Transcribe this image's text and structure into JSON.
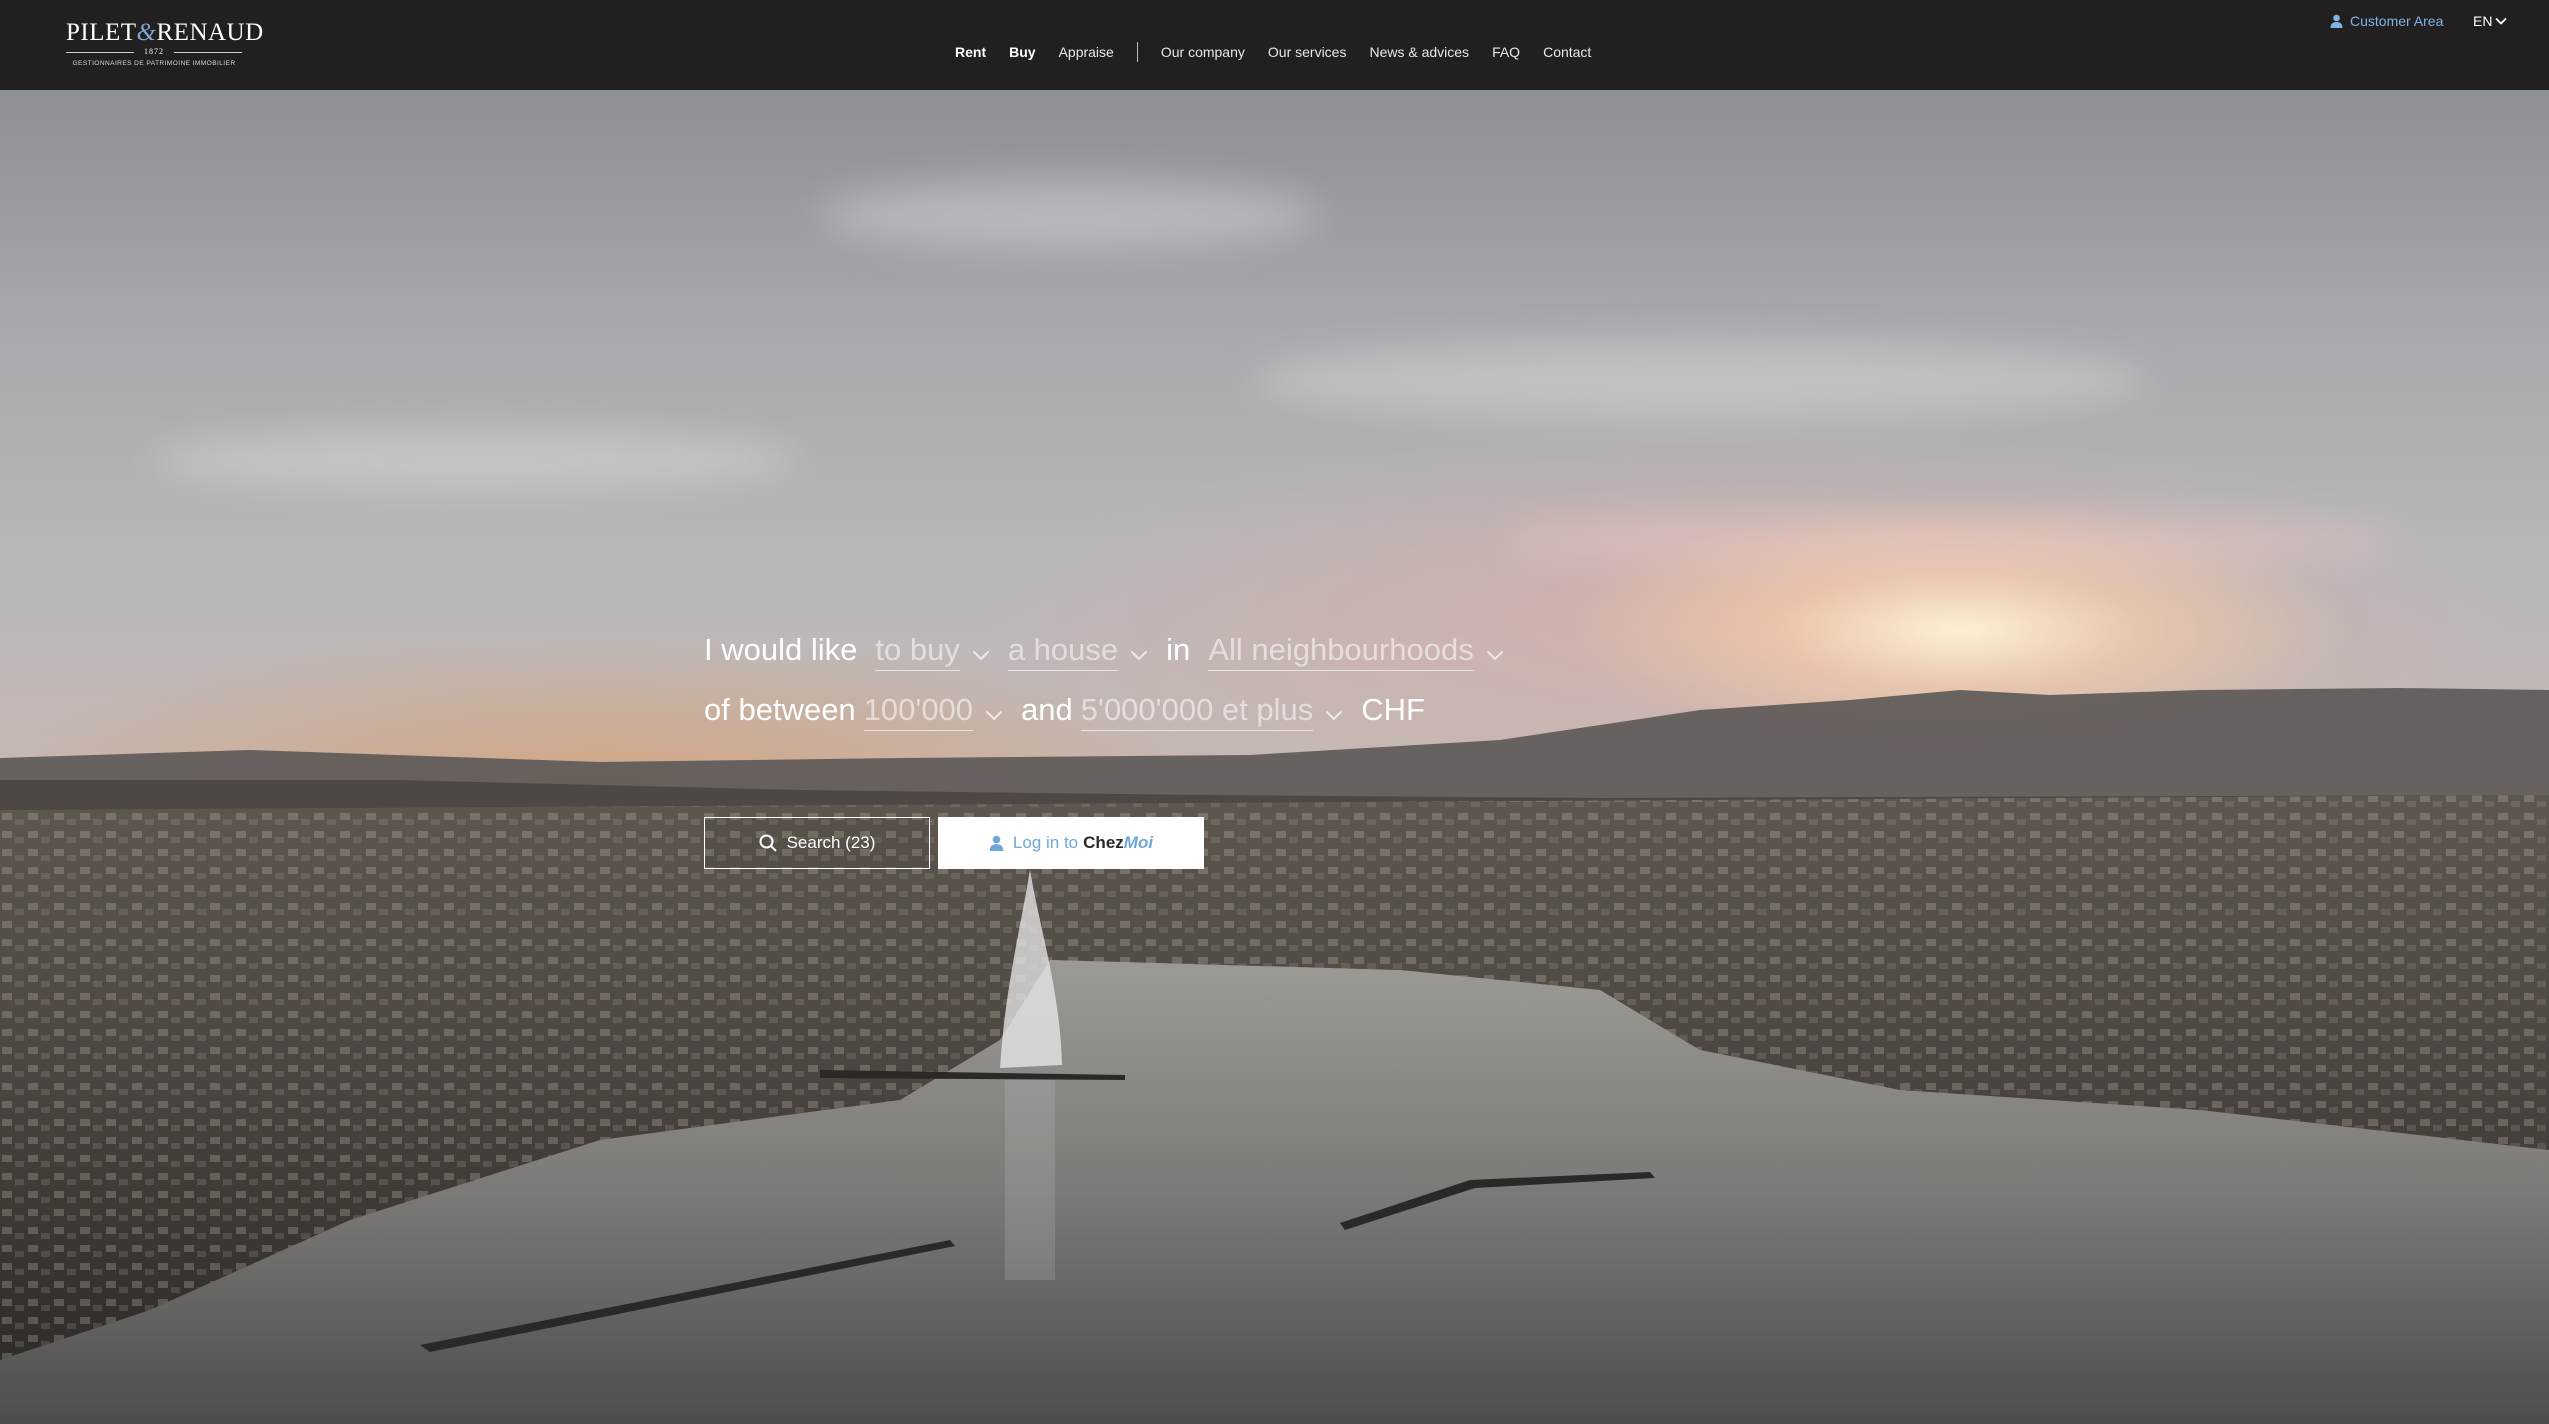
{
  "logo": {
    "brand_left": "PILET",
    "brand_amp": "&",
    "brand_right": "RENAUD",
    "year": "1872",
    "tagline": "GESTIONNAIRES DE PATRIMOINE IMMOBILIER"
  },
  "nav": {
    "primary": [
      "Rent",
      "Buy",
      "Appraise"
    ],
    "secondary": [
      "Our company",
      "Our services",
      "News & advices",
      "FAQ",
      "Contact"
    ]
  },
  "header": {
    "customer_area": "Customer Area",
    "language": "EN"
  },
  "search": {
    "prefix": "I would like",
    "transaction": "to buy",
    "property_type": "a house",
    "in_word": "in",
    "location": "All neighbourhoods",
    "between_word": "of between",
    "price_min": "100'000",
    "and_word": "and",
    "price_max": "5'000'000 et plus",
    "currency": "CHF",
    "search_button": "Search (23)",
    "login_prefix": "Log in to",
    "login_brand_bold": "Chez",
    "login_brand_italic": "Moi"
  },
  "colors": {
    "header_bg": "#211f1f",
    "accent_blue": "#6fa6dc"
  },
  "icons": {
    "user": "user-icon",
    "chevron": "chevron-down-icon",
    "search": "search-icon"
  }
}
